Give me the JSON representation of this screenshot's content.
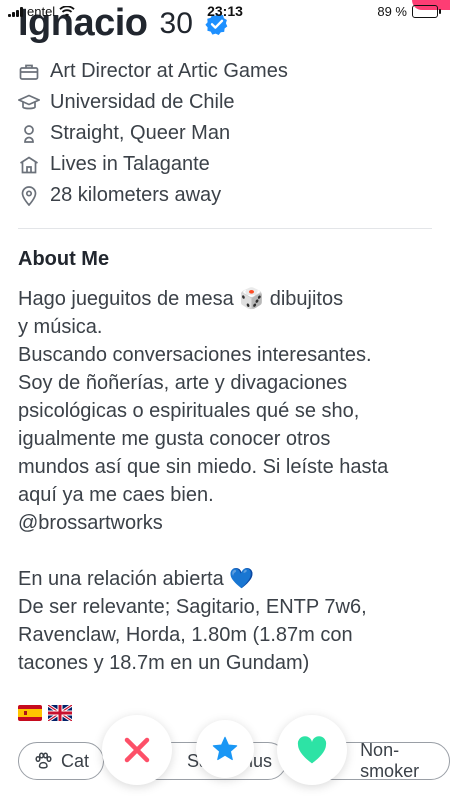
{
  "status_bar": {
    "carrier": "entel",
    "time": "23:13",
    "battery": "89 %",
    "battery_level": 0.89
  },
  "profile": {
    "name": "Ignacio",
    "age": "30",
    "verified": true
  },
  "info": [
    {
      "icon": "briefcase-icon",
      "text": "Art Director at Artic Games"
    },
    {
      "icon": "graduation-cap-icon",
      "text": "Universidad de Chile"
    },
    {
      "icon": "person-icon",
      "text": "Straight, Queer Man"
    },
    {
      "icon": "house-icon",
      "text": "Lives in Talagante"
    },
    {
      "icon": "location-pin-icon",
      "text": "28 kilometers away"
    }
  ],
  "about": {
    "title": "About Me",
    "text": "Hago jueguitos de mesa 🎲 dibujitos\ny música.\nBuscando conversaciones interesantes.\nSoy de ñoñerías, arte y divagaciones\npsicológicas o espirituales qué se sho,\nigualmente me gusta conocer otros\nmundos así que sin miedo. Si leíste hasta\naquí ya me caes bien.\n@brossartworks\n\nEn una relación abierta 💙\nDe ser relevante; Sagitario, ENTP 7w6,\nRavenclaw, Horda, 1.80m (1.87m con\ntacones y 18.7m en un Gundam)"
  },
  "flags": [
    "spain-flag",
    "uk-flag"
  ],
  "chips": [
    {
      "icon": "paw-icon",
      "label": "Cat"
    },
    {
      "icon": "",
      "label": "Sagittarius"
    },
    {
      "icon": "",
      "label": "Non-smoker"
    }
  ],
  "actions": {
    "nope_icon": "close-icon",
    "superlike_icon": "star-icon",
    "like_icon": "heart-icon"
  },
  "colors": {
    "accent": "#fd3d74",
    "nope": "#fd5068",
    "superlike": "#1a97f5",
    "like": "#2de3a5",
    "verified": "#1e90ff"
  }
}
